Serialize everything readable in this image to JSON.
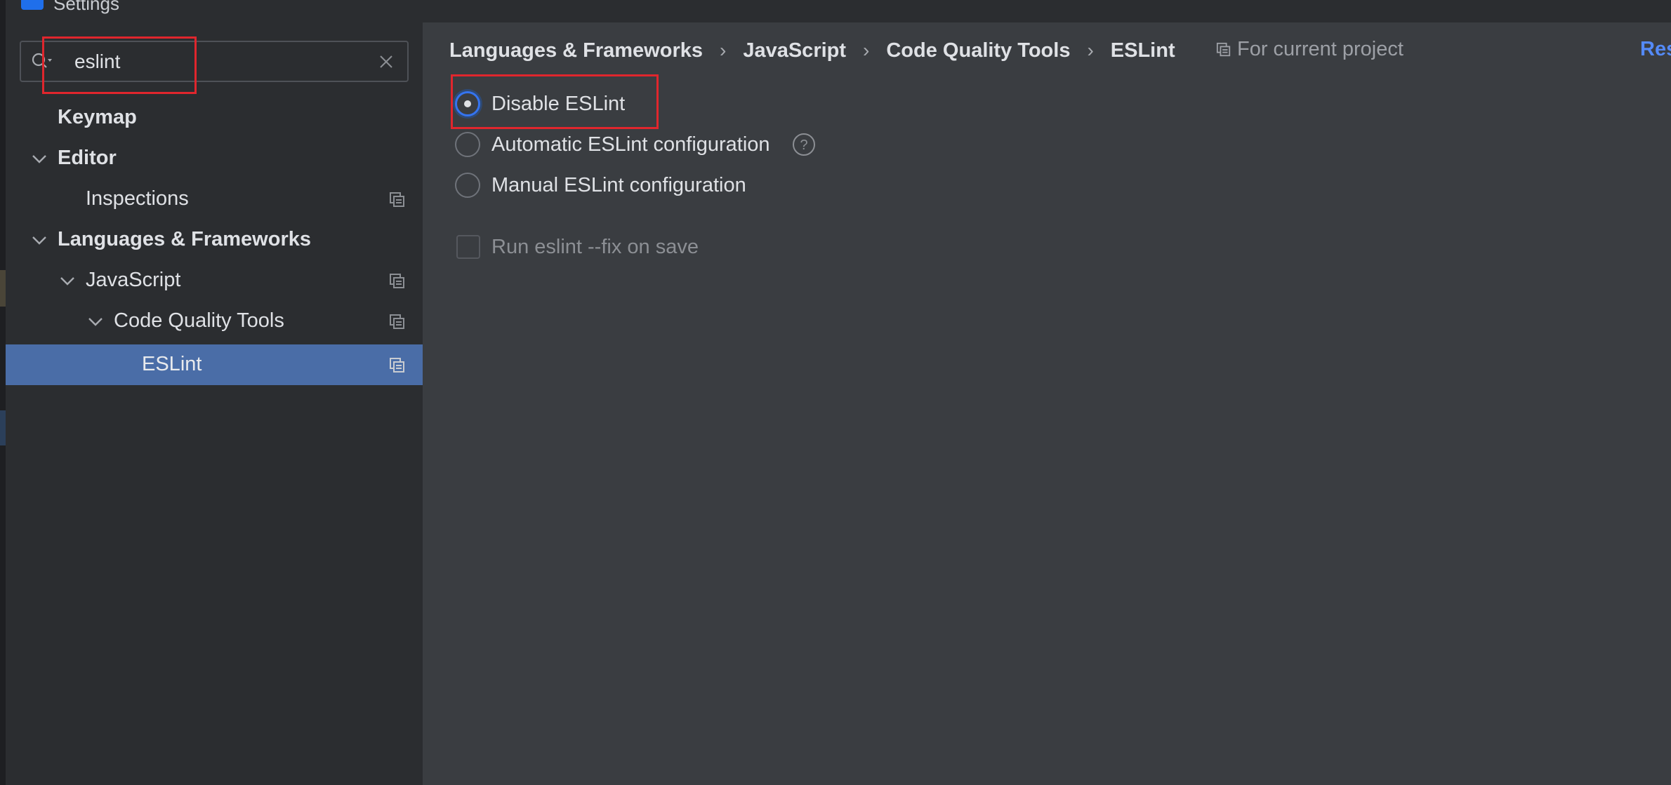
{
  "window": {
    "title": "Settings"
  },
  "search": {
    "value": "eslint"
  },
  "sidebar": {
    "items": [
      {
        "label": "Keymap"
      },
      {
        "label": "Editor"
      },
      {
        "label": "Inspections"
      },
      {
        "label": "Languages & Frameworks"
      },
      {
        "label": "JavaScript"
      },
      {
        "label": "Code Quality Tools"
      },
      {
        "label": "ESLint"
      }
    ],
    "selected": "ESLint"
  },
  "breadcrumb": {
    "items": [
      "Languages & Frameworks",
      "JavaScript",
      "Code Quality Tools",
      "ESLint"
    ],
    "separator": "›"
  },
  "scope": {
    "label": "For current project"
  },
  "reset": {
    "label": "Res"
  },
  "options": {
    "disable": "Disable ESLint",
    "automatic": "Automatic ESLint configuration",
    "manual": "Manual ESLint configuration",
    "selected": "Disable ESLint"
  },
  "fix_on_save": {
    "label": "Run eslint --fix on save",
    "checked": false
  },
  "colors": {
    "accent": "#3574f0",
    "selection": "#4a6da7",
    "highlight_box": "#e0262d",
    "link": "#548af7"
  }
}
